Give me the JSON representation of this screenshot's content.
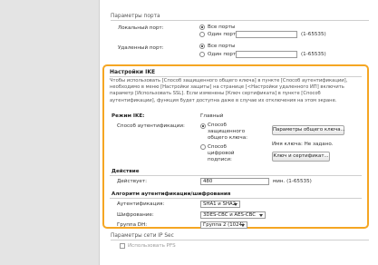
{
  "top_sections": {
    "ports_title": "Параметры порта",
    "local_port_label": "Локальный порт:",
    "local_all": "Все порты",
    "local_one": "Один порт:",
    "local_range": "(1-65535)",
    "remote_port_label": "Удаленный порт:",
    "remote_all": "Все порты",
    "remote_one": "Один порт:",
    "remote_range": "(1-65535)"
  },
  "ike": {
    "title": "Настройки IKE",
    "description": "Чтобы использовать [Способ защищенного общего ключа] в пункте [Способ аутентификации], необходимо в меню [Настройки защиты] на странице [<Настройки удаленного ИП] включить параметр [Использовать SSL]. Если изменены [Ключ сертификата] в пункте [Способ аутентификации], функция будет доступна даже в случае их отключения на этом экране.",
    "mode_label": "Режим IKE:",
    "mode_value": "Главный",
    "auth_label": "Способ аутентификации:",
    "auth_psk": "Способ защищенного общего ключа:",
    "auth_sig": "Способ цифровой подписи:",
    "psk_button": "Параметры общего ключа...",
    "key_name": "Имя ключа: Не задано.",
    "keys_button": "Ключ и сертификат...",
    "validity_title": "Действие",
    "validity_label": "Действует:",
    "validity_value": "480",
    "validity_unit": "мин. (1-65535)",
    "algo_title": "Алгоритм аутентификации/шифрования",
    "algo_auth_label": "Аутентификация:",
    "algo_auth_value": "SHA1 и SHA2",
    "algo_enc_label": "Шифрование:",
    "algo_enc_value": "3DES-CBC и AES-CBC",
    "algo_dh_label": "Группа DH:",
    "algo_dh_value": "Группа 2 (1024)"
  },
  "bottom": {
    "ipsec_title": "Параметры сети IP Sec",
    "pfs_label": "Использовать PFS"
  }
}
